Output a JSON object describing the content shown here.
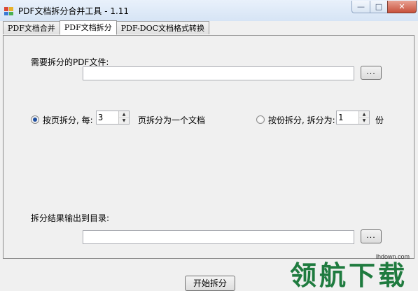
{
  "window": {
    "title": "PDF文档拆分合并工具 - 1.11",
    "minimize_glyph": "—",
    "maximize_glyph": "□",
    "close_glyph": "✕"
  },
  "tabs": [
    {
      "label": "PDF文档合并",
      "active": false
    },
    {
      "label": "PDF文档拆分",
      "active": true
    },
    {
      "label": "PDF-DOC文档格式转换",
      "active": false
    }
  ],
  "split": {
    "source_label": "需要拆分的PDF文件:",
    "source_value": "",
    "browse_label": "...",
    "by_page_label": "按页拆分, 每:",
    "by_page_value": "3",
    "by_page_suffix": "页拆分为一个文档",
    "by_part_label": "按份拆分, 拆分为:",
    "by_part_value": "1",
    "by_part_suffix": "份",
    "output_label": "拆分结果输出到目录:",
    "output_value": "",
    "output_browse_label": "...",
    "start_label": "开始拆分",
    "selected_mode": "by_page"
  },
  "watermark": {
    "text": "领航下载",
    "url": "lhdown.com",
    "color": "#1f7b3f"
  },
  "icons": {
    "spin_up": "▲",
    "spin_down": "▼"
  }
}
